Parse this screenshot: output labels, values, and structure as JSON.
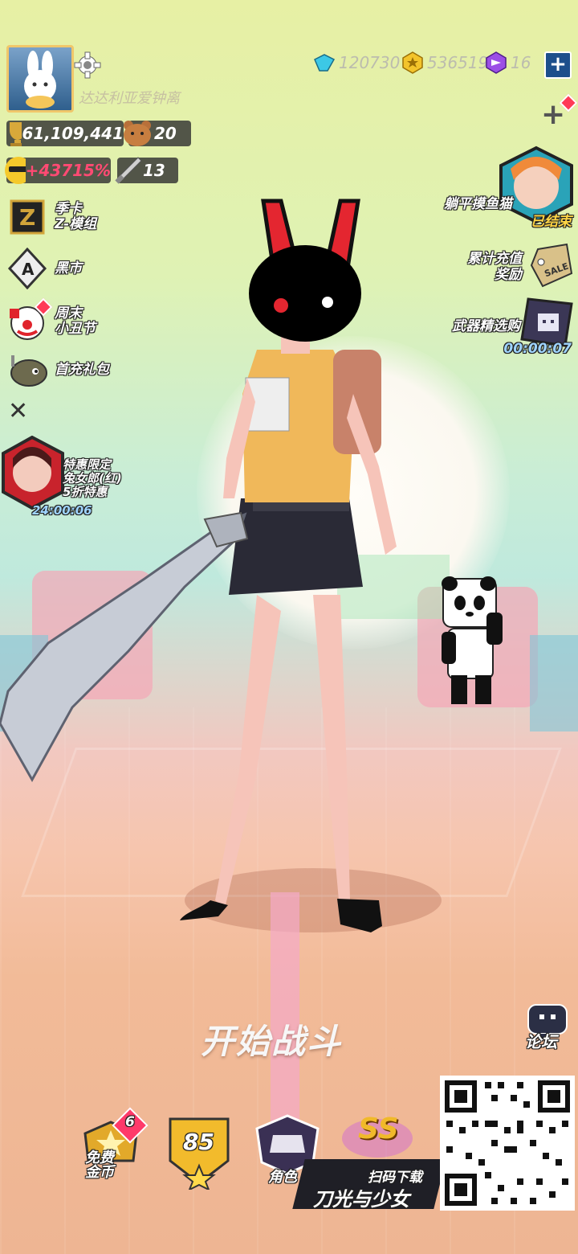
{
  "player": {
    "name": "达达利亚爱钟离",
    "trophies": "61,109,441",
    "bear_count": "20",
    "bonus_percent": "+43715%",
    "sword_count": "13"
  },
  "currency": {
    "diamonds": "120730",
    "coins": "536519",
    "tickets": "16"
  },
  "left_menu": [
    {
      "label": "季卡\nZ-模组",
      "icon": "z-card-icon"
    },
    {
      "label": "黑市",
      "icon": "ace-spade-icon"
    },
    {
      "label": "周末\n小丑节",
      "icon": "clown-icon"
    },
    {
      "label": "首充礼包",
      "icon": "pet-fish-icon"
    }
  ],
  "promo_card": {
    "line1": "特惠限定",
    "line2": "兔女郎(红)",
    "line3": "5折特惠",
    "timer": "24:00:06"
  },
  "right_menu": {
    "event_label": "躺平摸鱼猫",
    "event_status": "已结束",
    "recharge_label_1": "累计充值",
    "recharge_label_2": "奖励",
    "weapon_label": "武器精选购",
    "weapon_timer": "00:00:07",
    "sale_tag": "SALE"
  },
  "start_battle": "开始战斗",
  "forum_label": "论坛",
  "bottom": {
    "free_coins_label_1": "免费",
    "free_coins_label_2": "金币",
    "free_coins_badge": "6",
    "level": "85",
    "role_label": "角色",
    "rank": "SS"
  },
  "qr_promo": {
    "scan_text": "扫码下载",
    "game_title": "刀光与少女"
  },
  "colors": {
    "accent_red": "#ff3a56",
    "gold": "#f0c76a",
    "timer_blue": "#9fd4ff"
  }
}
